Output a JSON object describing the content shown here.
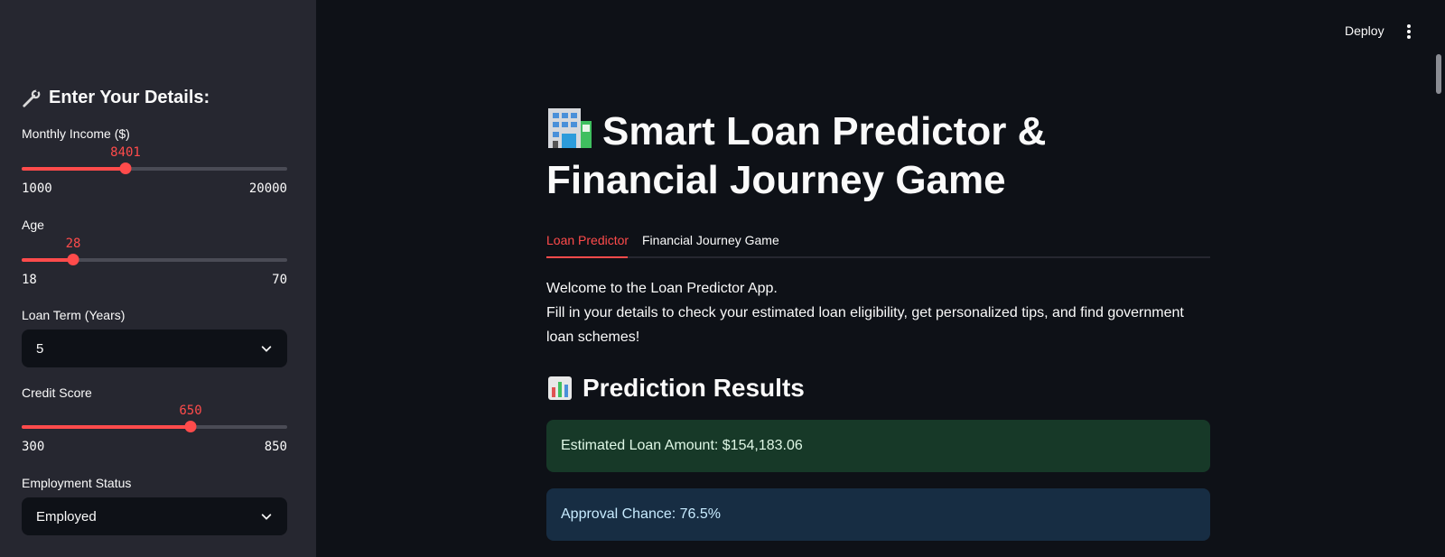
{
  "header": {
    "deploy_label": "Deploy",
    "menu_icon": "kebab-menu-icon"
  },
  "sidebar": {
    "heading": "Enter Your Details:",
    "heading_icon": "wrench-icon",
    "monthly_income": {
      "label": "Monthly Income ($)",
      "value": "8401",
      "min": "1000",
      "max": "20000",
      "fraction": 0.3896
    },
    "age": {
      "label": "Age",
      "value": "28",
      "min": "18",
      "max": "70",
      "fraction": 0.1923
    },
    "loan_term": {
      "label": "Loan Term (Years)",
      "value": "5"
    },
    "credit_score": {
      "label": "Credit Score",
      "value": "650",
      "min": "300",
      "max": "850",
      "fraction": 0.6364
    },
    "employment_status": {
      "label": "Employment Status",
      "value": "Employed"
    }
  },
  "main": {
    "title": "Smart Loan Predictor & Financial Journey Game",
    "title_icon": "office-building-icon",
    "tabs": [
      {
        "label": "Loan Predictor",
        "active": true
      },
      {
        "label": "Financial Journey Game",
        "active": false
      }
    ],
    "intro_line1": "Welcome to the Loan Predictor App.",
    "intro_line2": "Fill in your details to check your estimated loan eligibility, get personalized tips, and find government loan schemes!",
    "results_heading": "Prediction Results",
    "results_icon": "bar-chart-icon",
    "estimated_loan": "Estimated Loan Amount: $154,183.06",
    "approval_chance": "Approval Chance: 76.5%"
  },
  "colors": {
    "accent": "#ff4b4b",
    "success_bg": "#173928",
    "info_bg": "#172d43",
    "sidebar_bg": "#262730",
    "app_bg": "#0e1117"
  }
}
